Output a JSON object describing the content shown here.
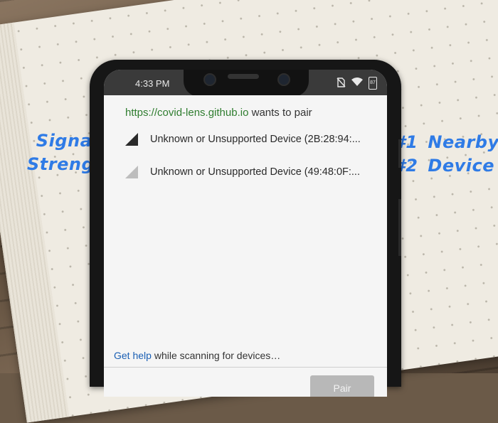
{
  "status_bar": {
    "time": "4:33 PM",
    "battery": "87"
  },
  "dialog": {
    "origin_url": "https://covid-lens.github.io",
    "origin_suffix": " wants to pair",
    "devices": [
      {
        "label": "Unknown or Unsupported Device (2B:28:94:...",
        "signal": "strong"
      },
      {
        "label": "Unknown or Unsupported Device (49:48:0F:...",
        "signal": "weak"
      }
    ],
    "help_link": "Get help",
    "help_text": " while scanning for devices…",
    "pair_label": "Pair"
  },
  "annotations": {
    "left_line1": "Signal",
    "left_line2": "Strength",
    "right_num1": "#1",
    "right_num2": "#2",
    "right_word1": "Nearby",
    "right_word2": "Device"
  },
  "colors": {
    "annotation": "#2f7be6",
    "link": "#1a5fb4",
    "url": "#2f7d2f",
    "pair_button": "#b8b8b8"
  }
}
